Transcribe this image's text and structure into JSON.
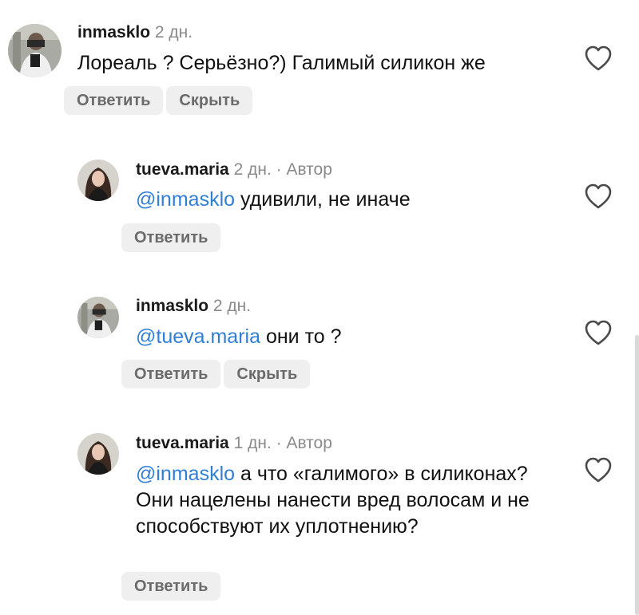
{
  "comments": [
    {
      "username": "inmasklo",
      "time": "2 дн.",
      "author_badge": "",
      "mention": "",
      "text": "Лореаль ? Серьёзно?) Галимый силикон же",
      "actions": [
        "Ответить",
        "Скрыть"
      ]
    },
    {
      "username": "tueva.maria",
      "time": "2 дн.",
      "author_badge": "· Автор",
      "mention": "@inmasklo",
      "text": " удивили, не иначе",
      "actions": [
        "Ответить"
      ]
    },
    {
      "username": "inmasklo",
      "time": "2 дн.",
      "author_badge": "",
      "mention": "@tueva.maria",
      "text": " они то ?",
      "actions": [
        "Ответить",
        "Скрыть"
      ]
    },
    {
      "username": "tueva.maria",
      "time": "1 дн.",
      "author_badge": "· Автор",
      "mention": "@inmasklo",
      "text": " а что «галимого» в силиконах? Они нацелены нанести вред волосам и не способствуют их уплотнению?",
      "actions": [
        "Ответить"
      ]
    }
  ],
  "icons": {
    "like": "heart-icon"
  },
  "colors": {
    "mention": "#2f7fd6",
    "meta": "#8a8a8a",
    "button_bg": "#efefef",
    "button_text": "#6b6b6b"
  }
}
